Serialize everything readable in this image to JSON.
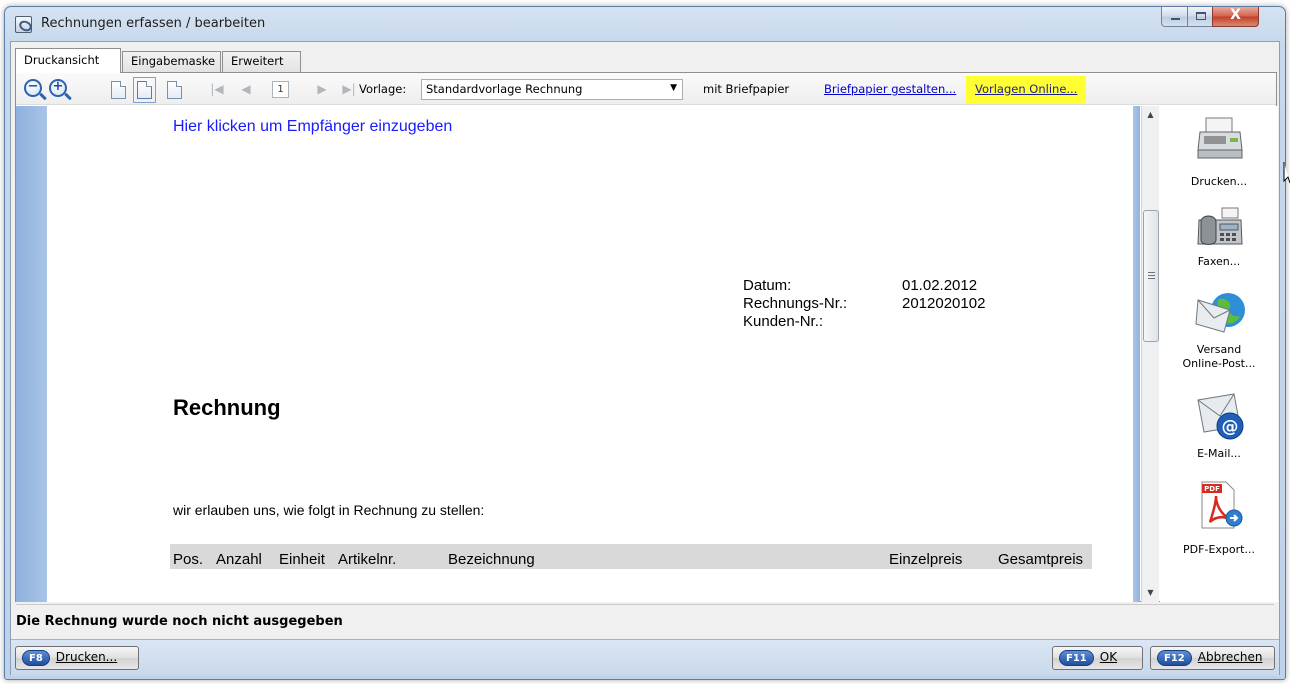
{
  "window": {
    "title": "Rechnungen erfassen / bearbeiten",
    "controls": {
      "minimize": "–",
      "maximize": "□",
      "close": "X"
    }
  },
  "tabs": [
    {
      "label": "Druckansicht",
      "active": true
    },
    {
      "label": "Eingabemaske",
      "active": false
    },
    {
      "label": "Erweitert",
      "active": false
    }
  ],
  "toolbar": {
    "page_number": "1",
    "template_label": "Vorlage:",
    "template_value": "Standardvorlage Rechnung",
    "letterhead_label": "mit Briefpapier",
    "design_letterhead_link": "Briefpapier gestalten...",
    "online_templates_link": "Vorlagen Online...",
    "highlight_color": "#ffff33"
  },
  "document": {
    "recipient_placeholder": "Hier klicken um Empfänger einzugeben",
    "meta": [
      {
        "label": "Datum:",
        "value": "01.02.2012"
      },
      {
        "label": "Rechnungs-Nr.:",
        "value": "2012020102"
      },
      {
        "label": "Kunden-Nr.:",
        "value": ""
      }
    ],
    "heading": "Rechnung",
    "intro": "wir erlauben uns, wie folgt in Rechnung zu stellen:",
    "table_headers": [
      "Pos.",
      "Anzahl",
      "Einheit",
      "Artikelnr.",
      "Bezeichnung",
      "Einzelpreis",
      "Gesamtpreis"
    ]
  },
  "side_actions": [
    {
      "label": "Drucken...",
      "icon": "printer-icon"
    },
    {
      "label": "Faxen...",
      "icon": "fax-icon"
    },
    {
      "label_line1": "Versand",
      "label_line2": "Online-Post...",
      "icon": "online-post-icon"
    },
    {
      "label": "E-Mail...",
      "icon": "email-icon"
    },
    {
      "label": "PDF-Export...",
      "icon": "pdf-export-icon"
    }
  ],
  "status_text": "Die Rechnung wurde noch nicht ausgegeben",
  "buttons": {
    "print": {
      "key": "F8",
      "label": "Drucken..."
    },
    "ok": {
      "key": "F11",
      "label": "OK"
    },
    "cancel": {
      "key": "F12",
      "label": "Abbrechen"
    }
  }
}
